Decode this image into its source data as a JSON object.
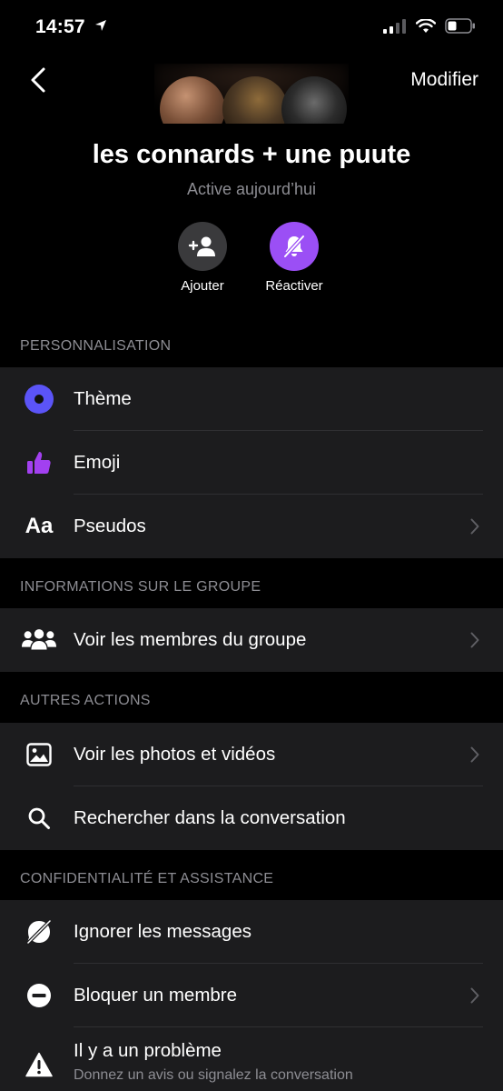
{
  "status_bar": {
    "time": "14:57"
  },
  "nav": {
    "edit_label": "Modifier"
  },
  "group": {
    "name": "les connards + une puute",
    "status": "Active aujourd’hui"
  },
  "actions": {
    "add_label": "Ajouter",
    "unmute_label": "Réactiver"
  },
  "sections": [
    {
      "header": "PERSONNALISATION",
      "items": [
        {
          "label": "Thème",
          "icon": "theme-circle-icon"
        },
        {
          "label": "Emoji",
          "icon": "thumbs-up-icon"
        },
        {
          "label": "Pseudos",
          "icon": "font-aa-icon"
        }
      ]
    },
    {
      "header": "INFORMATIONS SUR LE GROUPE",
      "items": [
        {
          "label": "Voir les membres du groupe",
          "icon": "people-icon"
        }
      ]
    },
    {
      "header": "AUTRES ACTIONS",
      "items": [
        {
          "label": "Voir les photos et vidéos",
          "icon": "photo-icon"
        },
        {
          "label": "Rechercher dans la conversation",
          "icon": "search-icon"
        }
      ]
    },
    {
      "header": "CONFIDENTIALITÉ ET ASSISTANCE",
      "items": [
        {
          "label": "Ignorer les messages",
          "icon": "ignore-icon"
        },
        {
          "label": "Bloquer un membre",
          "icon": "block-icon"
        },
        {
          "label": "Il y a un problème",
          "sublabel": "Donnez un avis ou signalez la conversation",
          "icon": "warning-icon"
        }
      ]
    }
  ],
  "colors": {
    "accent_purple": "#9b4ff5",
    "theme_blue": "#5b54f7",
    "emoji_purple": "#a240f0",
    "row_bg": "#1c1c1e",
    "secondary_text": "#8d8d93"
  }
}
